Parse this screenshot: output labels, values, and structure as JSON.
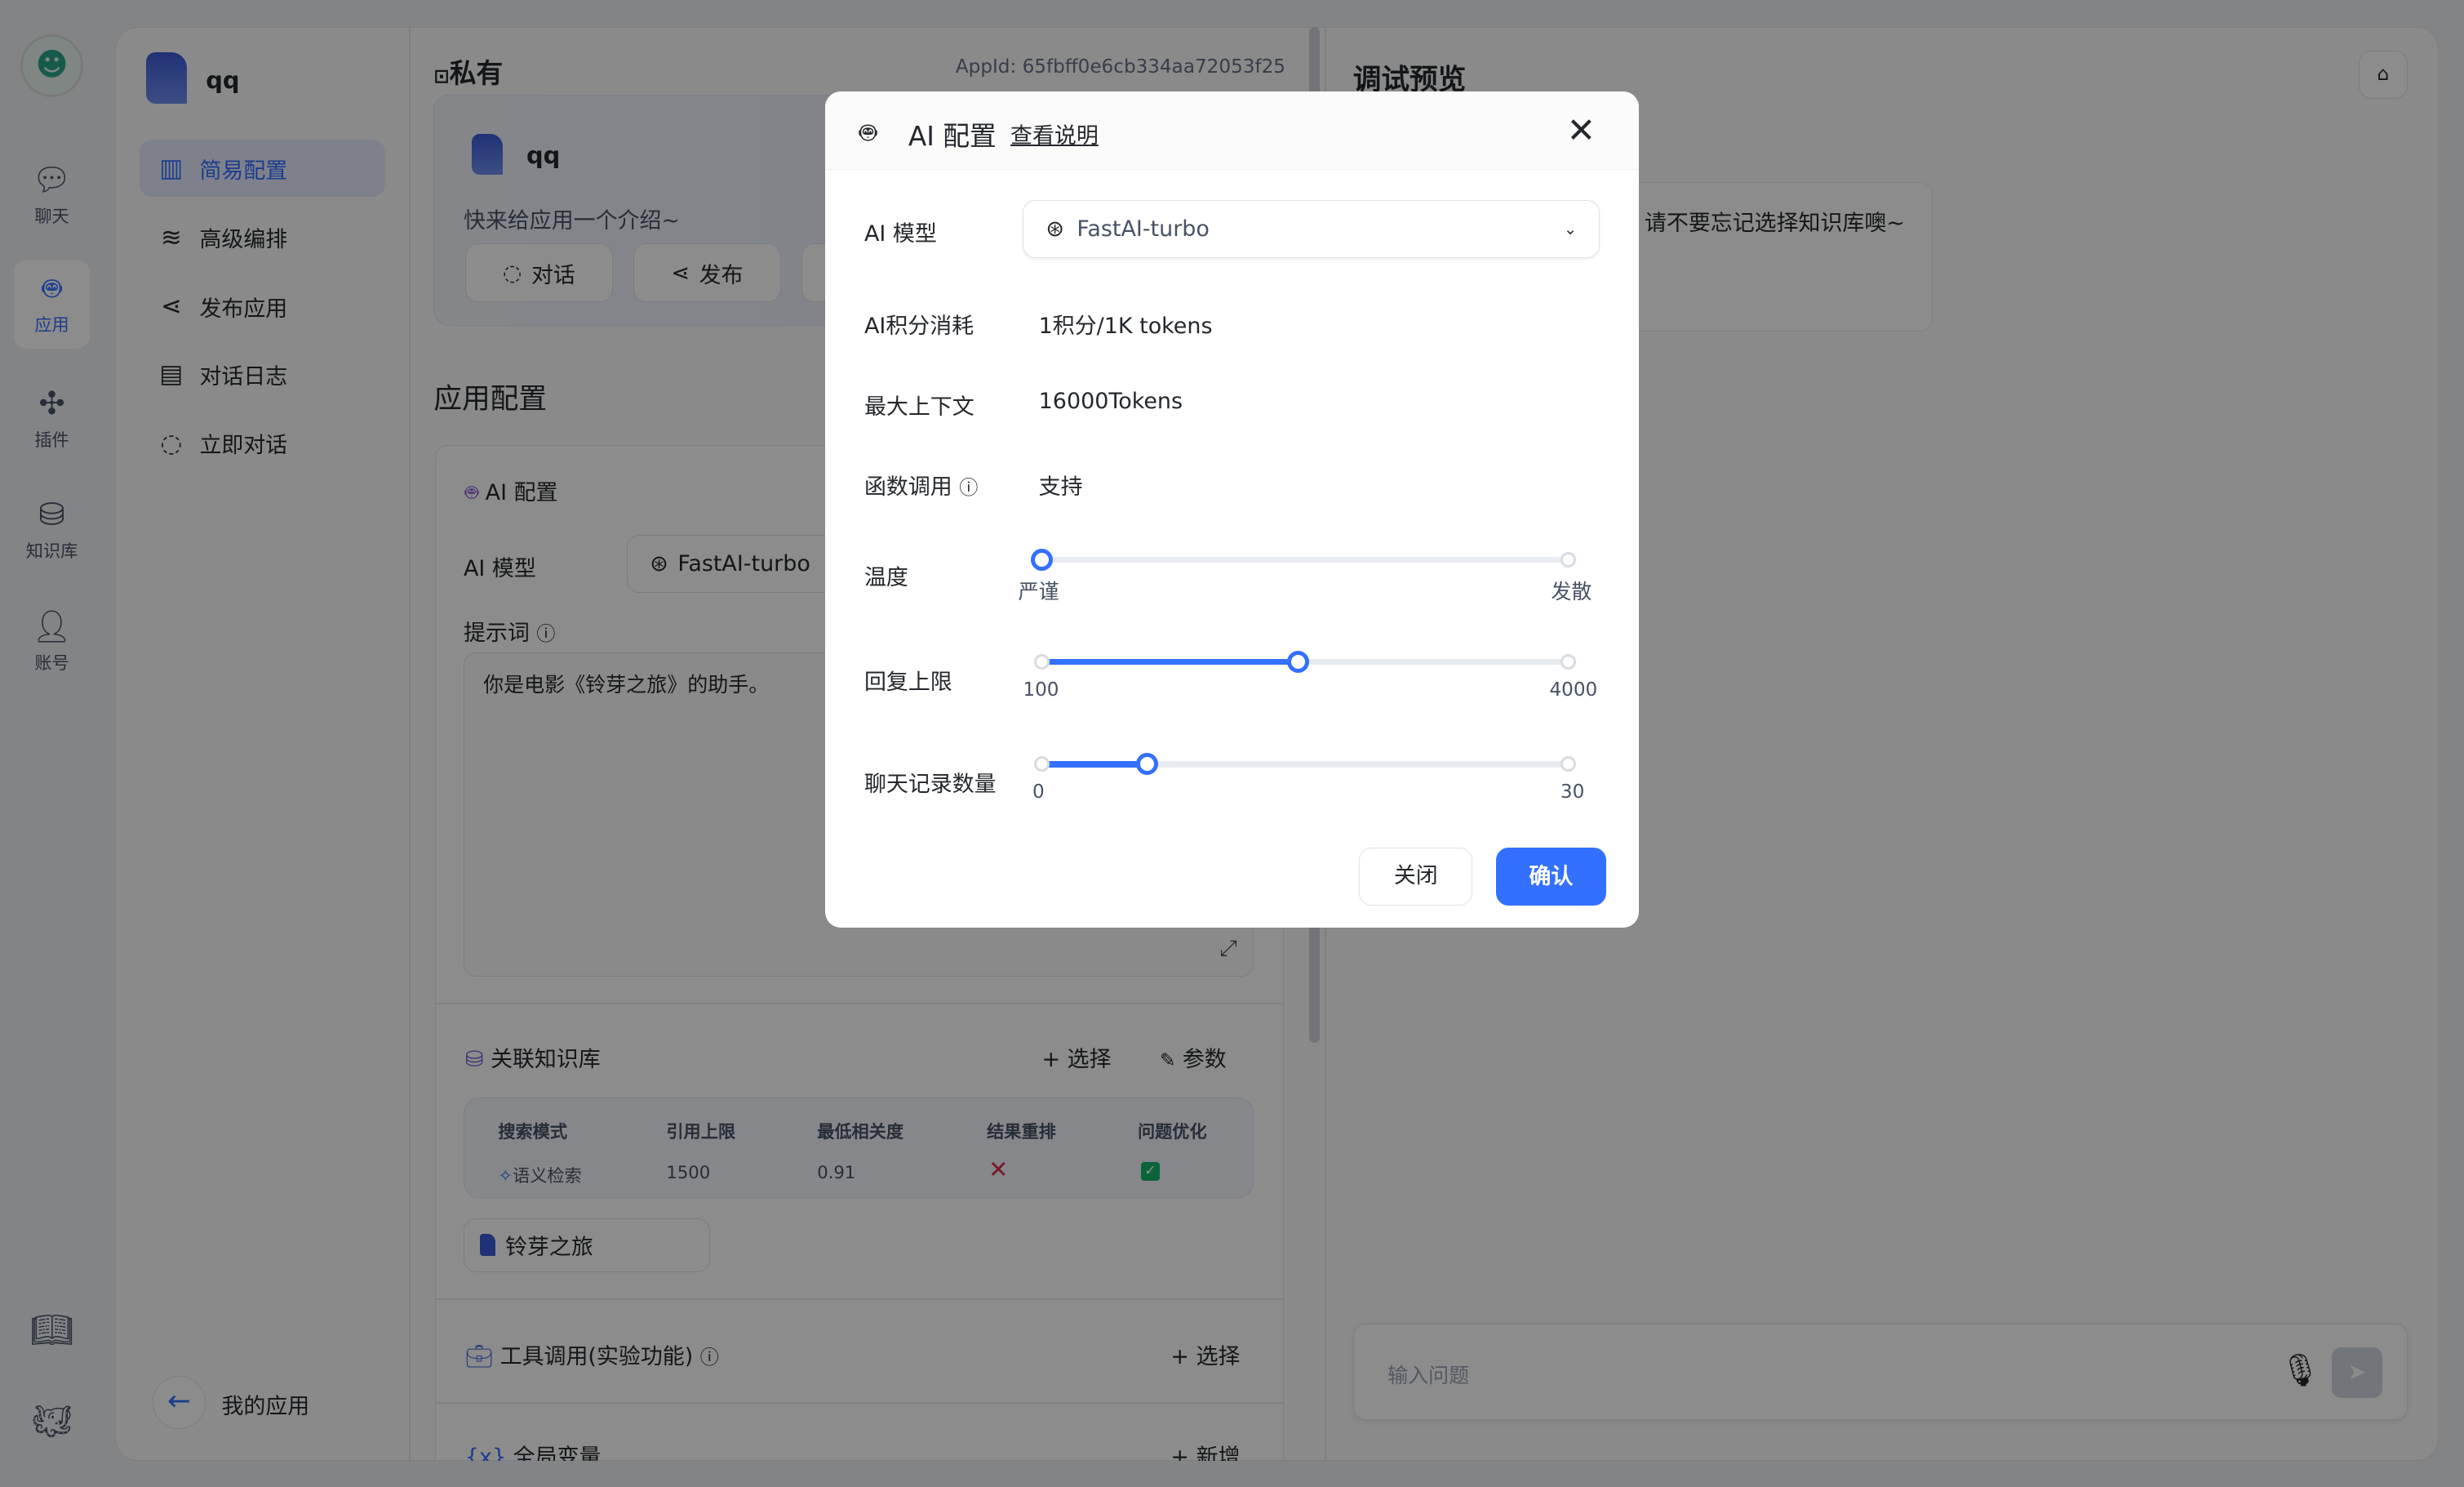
{
  "rail": {
    "items": [
      {
        "label": "聊天",
        "icon": "chat-icon"
      },
      {
        "label": "应用",
        "icon": "robot-icon",
        "active": true
      },
      {
        "label": "插件",
        "icon": "puzzle-icon"
      },
      {
        "label": "知识库",
        "icon": "database-icon"
      },
      {
        "label": "账号",
        "icon": "user-icon"
      }
    ],
    "bottom": [
      "book-icon",
      "github-icon"
    ]
  },
  "sidebar": {
    "app_name": "qq",
    "items": [
      {
        "label": "简易配置",
        "active": true
      },
      {
        "label": "高级编排"
      },
      {
        "label": "发布应用"
      },
      {
        "label": "对话日志"
      },
      {
        "label": "立即对话"
      }
    ],
    "back_label": "我的应用"
  },
  "main": {
    "visibility": "私有",
    "app_id": "AppId: 65fbff0e6cb334aa72053f25",
    "card": {
      "name": "qq",
      "intro": "快来给应用一个介绍~",
      "buttons": [
        "对话",
        "发布"
      ]
    },
    "section_title": "应用配置",
    "ai_config": {
      "title": "AI 配置",
      "model_label": "AI 模型",
      "model": "FastAI-turbo",
      "prompt_label": "提示词",
      "prompt": "你是电影《铃芽之旅》的助手。"
    },
    "kb": {
      "title": "关联知识库",
      "select": "选择",
      "params": "参数",
      "headers": [
        "搜索模式",
        "引用上限",
        "最低相关度",
        "结果重排",
        "问题优化"
      ],
      "row": {
        "mode": "语义检索",
        "limit": "1500",
        "similarity": "0.91",
        "rerank": false,
        "optimize": true
      },
      "dataset": "铃芽之旅"
    },
    "tools": {
      "title": "工具调用(实验功能)",
      "select": "选择"
    },
    "vars": {
      "title": "全局变量",
      "add": "新增"
    }
  },
  "preview": {
    "title": "调试预览",
    "message": "请不要忘记选择知识库噢~",
    "input_placeholder": "输入问题"
  },
  "modal": {
    "title": "AI 配置",
    "help_link": "查看说明",
    "model_label": "AI 模型",
    "model": "FastAI-turbo",
    "points_label": "AI积分消耗",
    "points": "1积分/1K tokens",
    "context_label": "最大上下文",
    "context": "16000Tokens",
    "function_label": "函数调用",
    "function": "支持",
    "temperature": {
      "label": "温度",
      "min_label": "严谨",
      "max_label": "发散",
      "min": 0,
      "max": 10,
      "value": 0
    },
    "max_tokens": {
      "label": "回复上限",
      "min_label": "100",
      "max_label": "4000",
      "min": 100,
      "max": 4000,
      "value": 2000
    },
    "history": {
      "label": "聊天记录数量",
      "min_label": "0",
      "max_label": "30",
      "min": 0,
      "max": 30,
      "value": 6
    },
    "close_label": "关闭",
    "confirm_label": "确认"
  },
  "colors": {
    "accent": "#3370ff",
    "rerank_false": "#d92d4b",
    "optimize_true": "#12b76a"
  }
}
